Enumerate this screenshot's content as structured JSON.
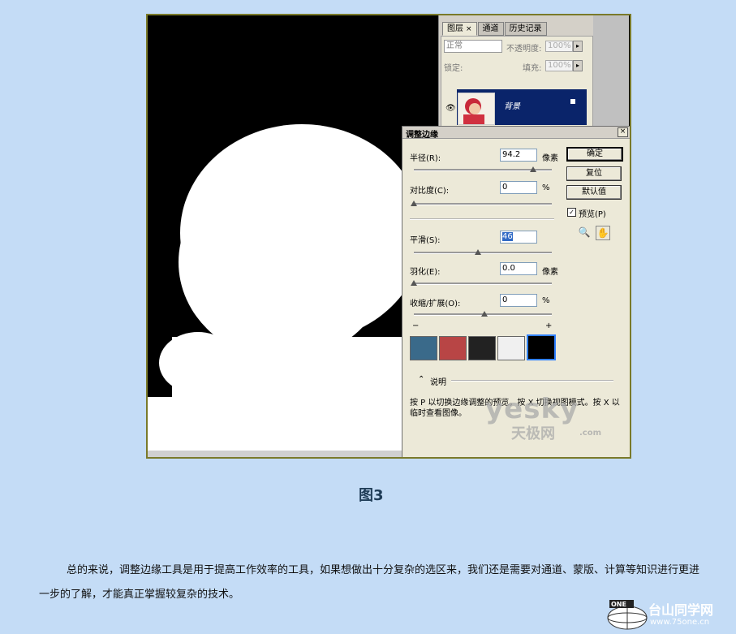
{
  "layers_panel": {
    "tabs": [
      "图层",
      "通道",
      "历史记录"
    ],
    "tab_close": "×",
    "blend_mode": "正常",
    "opacity_label": "不透明度:",
    "opacity_value": "100%",
    "lock_label": "锁定:",
    "fill_label": "填充:",
    "fill_value": "100%",
    "layer_name": "背景"
  },
  "dialog": {
    "title": "调整边缘",
    "close": "×",
    "radius_label": "半径(R):",
    "radius_value": "94.2",
    "radius_unit": "像素",
    "contrast_label": "对比度(C):",
    "contrast_value": "0",
    "contrast_unit": "%",
    "smooth_label": "平滑(S):",
    "smooth_value": "46",
    "feather_label": "羽化(E):",
    "feather_value": "0.0",
    "feather_unit": "像素",
    "contract_label": "收缩/扩展(O):",
    "contract_value": "0",
    "contract_unit": "%",
    "minus": "−",
    "plus": "+",
    "ok": "确定",
    "reset": "复位",
    "default": "默认值",
    "preview_label": "预览(P)",
    "desc_toggle": "说明",
    "desc_text": "按 P 以切换边缘调整的预览。按 X 切换视图模式。按 X 以临时查看图像。"
  },
  "watermark": {
    "main": "yesky",
    "sub": "天极网",
    "com": ".com"
  },
  "caption": "图3",
  "paragraph": "总的来说，调整边缘工具是用于提高工作效率的工具，如果想做出十分复杂的选区来，我们还是需要对通道、蒙版、计算等知识进行更进一步的了解，才能真正掌握较复杂的技术。",
  "site_logo": {
    "name": "台山同学网",
    "url": "www.75one.cn",
    "badge": "ONE"
  }
}
